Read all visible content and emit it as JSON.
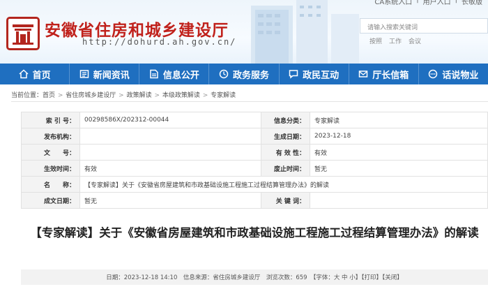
{
  "header": {
    "top_links": [
      "CA系统入口",
      "|",
      "用户入口",
      "|",
      "长敬版"
    ],
    "site_title": "安徽省住房和城乡建设厅",
    "site_url": "http://dohurd.ah.gov.cn/",
    "search_placeholder": "请输入搜索关键词",
    "hot_words": [
      "按照",
      "工作",
      "会议"
    ],
    "brand_color": "#c0211b"
  },
  "nav": {
    "color": "#1f6fc0",
    "items": [
      {
        "label": "首页",
        "icon": "home-icon"
      },
      {
        "label": "新闻资讯",
        "icon": "news-icon"
      },
      {
        "label": "信息公开",
        "icon": "document-icon"
      },
      {
        "label": "政务服务",
        "icon": "service-icon"
      },
      {
        "label": "政民互动",
        "icon": "chat-icon"
      },
      {
        "label": "厅长信箱",
        "icon": "mailbox-icon"
      },
      {
        "label": "话说物业",
        "icon": "talk-icon"
      }
    ]
  },
  "breadcrumb": {
    "prefix": "当前位置：",
    "items": [
      "首页",
      "省住房城乡建设厅",
      "政策解读",
      "本级政策解读",
      "专家解读"
    ]
  },
  "info": {
    "rows": [
      {
        "l1": "索 引 号：",
        "v1": "00298586X/202312-00044",
        "l2": "信息分类：",
        "v2": "专家解读"
      },
      {
        "l1": "发布机构：",
        "v1": "",
        "l2": "生成日期：",
        "v2": "2023-12-18"
      },
      {
        "l1": "文　　号：",
        "v1": "",
        "l2": "有 效 性：",
        "v2": "有效"
      },
      {
        "l1": "生效时间：",
        "v1": "有效",
        "l2": "废止时间：",
        "v2": "暂无"
      }
    ],
    "name_label": "名　　称：",
    "name_value": "【专家解读】关于《安徽省房屋建筑和市政基础设施工程施工过程结算管理办法》的解读",
    "last": {
      "l1": "成文日期：",
      "v1": "暂无",
      "l2": "关 键 词：",
      "v2": ""
    }
  },
  "article": {
    "title": "【专家解读】关于《安徽省房屋建筑和市政基础设施工程施工过程结算管理办法》的解读",
    "meta": "日期：2023-12-18 14:10　信息来源：省住房城乡建设厅　浏览次数：659　【字体：大 中 小】【打印】【关闭】"
  }
}
